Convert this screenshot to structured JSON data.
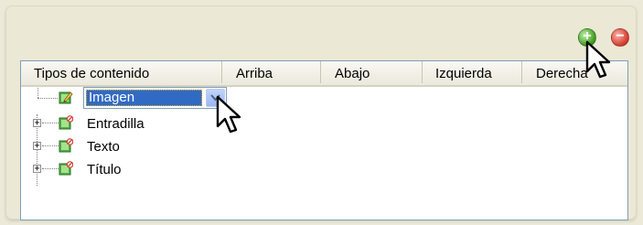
{
  "toolbar": {
    "add_icon": "plus-circle-icon",
    "add_color": "#3c9a1c",
    "add_glyph": "+",
    "remove_icon": "minus-circle-icon",
    "remove_color": "#d23a2c",
    "remove_glyph": "−"
  },
  "grid": {
    "columns": [
      "Tipos de contenido",
      "Arriba",
      "Abajo",
      "Izquierda",
      "Derecha"
    ],
    "rows": [
      {
        "label": "Imagen",
        "icon": "content-edit-icon",
        "editing": true
      },
      {
        "label": "Entradilla",
        "icon": "content-icon",
        "expander": "+"
      },
      {
        "label": "Texto",
        "icon": "content-icon",
        "expander": "+"
      },
      {
        "label": "Título",
        "icon": "content-icon",
        "expander": "+"
      }
    ],
    "combo": {
      "value": "Imagen",
      "arrow_icon": "chevron-down-icon"
    }
  },
  "colors": {
    "selection": "#316ac5",
    "border": "#7f9db9"
  }
}
